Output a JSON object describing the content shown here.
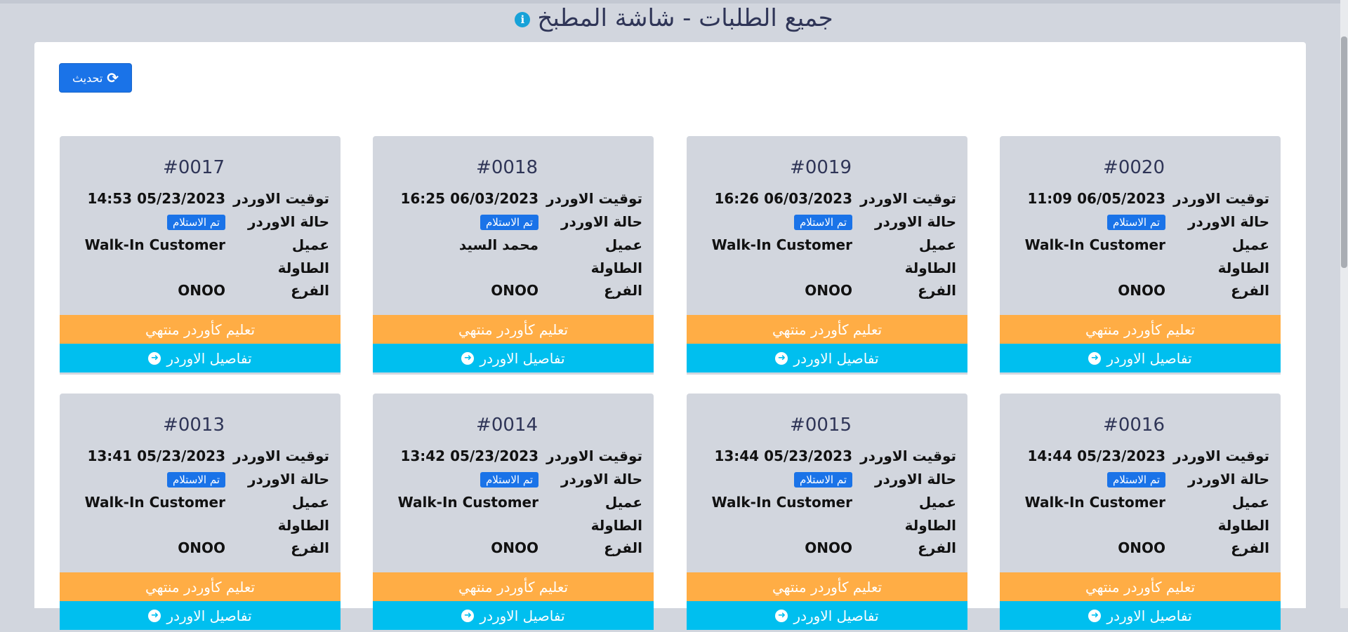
{
  "header": {
    "title": "جميع الطلبات - شاشة المطبخ",
    "info_icon": "info-icon"
  },
  "toolbar": {
    "refresh_label": "تحديث",
    "refresh_icon": "refresh-icon"
  },
  "labels": {
    "order_time": "توقيت الاوردر",
    "order_status": "حالة الاوردر",
    "customer": "عميل",
    "table": "الطاولة",
    "branch": "الفرع",
    "finish_button": "تعليم كأوردر منتهي",
    "details_button": "تفاصيل الاوردر"
  },
  "colors": {
    "finish": "#ffad45",
    "details": "#00bfef",
    "badge": "#1a73e8",
    "card_bg": "#d2d6de"
  },
  "orders": [
    {
      "number": "#0020",
      "time": "11:09 06/05/2023",
      "status": "تم الاستلام",
      "customer": "Walk-In Customer",
      "table": "",
      "branch": "ONOO"
    },
    {
      "number": "#0019",
      "time": "16:26 06/03/2023",
      "status": "تم الاستلام",
      "customer": "Walk-In Customer",
      "table": "",
      "branch": "ONOO"
    },
    {
      "number": "#0018",
      "time": "16:25 06/03/2023",
      "status": "تم الاستلام",
      "customer": "محمد السيد",
      "table": "",
      "branch": "ONOO"
    },
    {
      "number": "#0017",
      "time": "14:53 05/23/2023",
      "status": "تم الاستلام",
      "customer": "Walk-In Customer",
      "table": "",
      "branch": "ONOO"
    },
    {
      "number": "#0016",
      "time": "14:44 05/23/2023",
      "status": "تم الاستلام",
      "customer": "Walk-In Customer",
      "table": "",
      "branch": "ONOO"
    },
    {
      "number": "#0015",
      "time": "13:44 05/23/2023",
      "status": "تم الاستلام",
      "customer": "Walk-In Customer",
      "table": "",
      "branch": "ONOO"
    },
    {
      "number": "#0014",
      "time": "13:42 05/23/2023",
      "status": "تم الاستلام",
      "customer": "Walk-In Customer",
      "table": "",
      "branch": "ONOO"
    },
    {
      "number": "#0013",
      "time": "13:41 05/23/2023",
      "status": "تم الاستلام",
      "customer": "Walk-In Customer",
      "table": "",
      "branch": "ONOO"
    }
  ]
}
